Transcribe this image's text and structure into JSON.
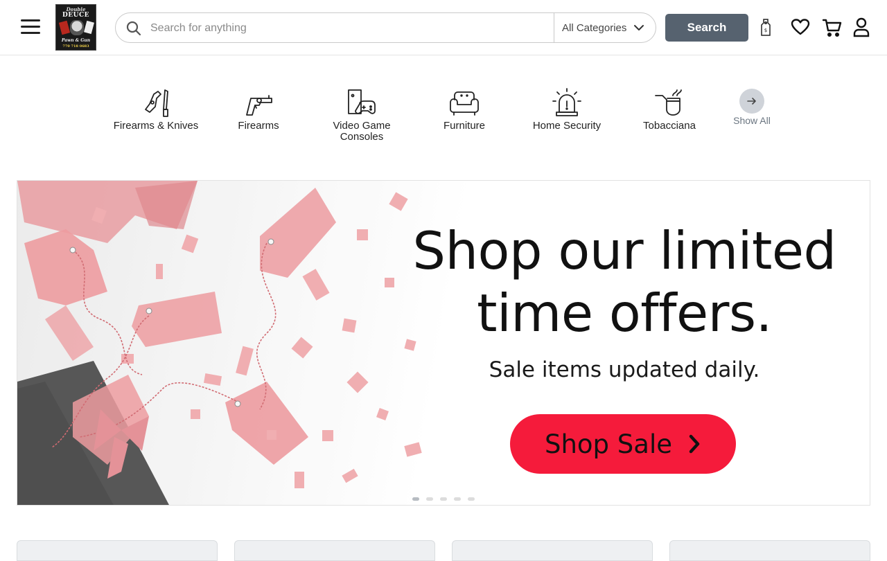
{
  "header": {
    "logo": {
      "line1": "Double",
      "line2": "DEUCE",
      "line3": "Pawn & Gun",
      "phone": "770 718 0683"
    },
    "search": {
      "placeholder": "Search for anything",
      "value": "",
      "category": "All Categories",
      "button_label": "Search"
    },
    "icons": [
      "price-tag-icon",
      "heart-icon",
      "cart-icon",
      "user-icon"
    ]
  },
  "categories": [
    {
      "label": "Firearms & Knives",
      "icon": "gun-knife-icon"
    },
    {
      "label": "Firearms",
      "icon": "revolver-icon"
    },
    {
      "label": "Video Game Consoles",
      "icon": "game-console-icon"
    },
    {
      "label": "Furniture",
      "icon": "sofa-icon"
    },
    {
      "label": "Home Security",
      "icon": "alarm-light-icon"
    },
    {
      "label": "Tobacciana",
      "icon": "pipe-icon"
    }
  ],
  "show_all": {
    "label": "Show All",
    "icon": "arrow-right-icon"
  },
  "banner": {
    "title": "Shop our limited time offers.",
    "subtitle": "Sale items updated daily.",
    "cta_label": "Shop Sale",
    "slides": 5,
    "active_slide": 1
  },
  "colors": {
    "search_button": "#56626f",
    "cta": "#f51b3b",
    "tag_red": "#ea8b8f"
  }
}
